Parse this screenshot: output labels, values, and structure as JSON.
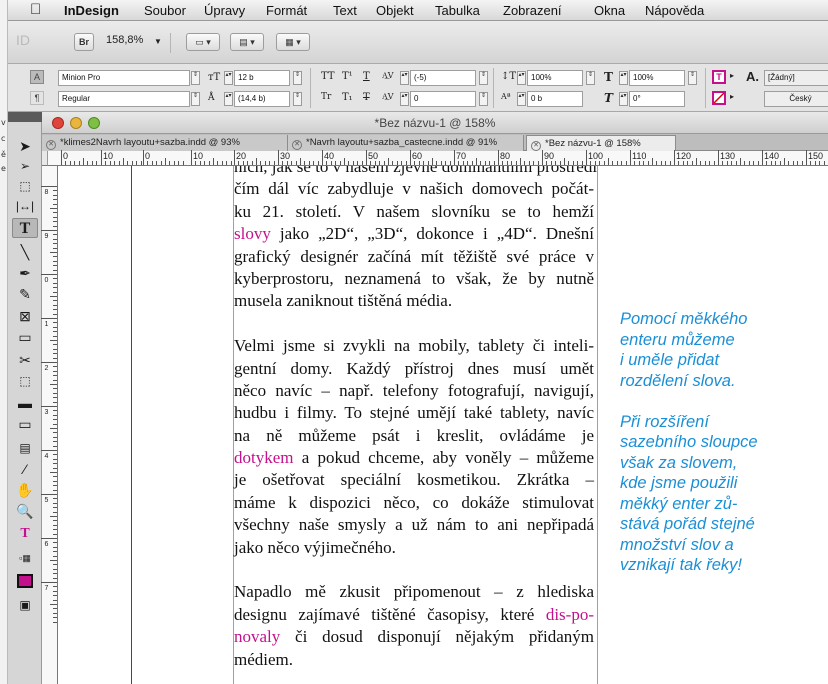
{
  "menu": {
    "app": "InDesign",
    "items": [
      "Soubor",
      "Úpravy",
      "Formát",
      "Text",
      "Objekt",
      "Tabulka",
      "Zobrazení",
      "Okna",
      "Nápověda"
    ]
  },
  "appbar": {
    "logo": "ID",
    "bridge": "Br",
    "zoom": "158,8%"
  },
  "control": {
    "font_family": "Minion Pro",
    "font_style": "Regular",
    "font_size": "12 b",
    "leading": "(14,4 b)",
    "tracking": "(-5)",
    "kerning": "0",
    "vscale": "100%",
    "hscale": "100%",
    "baseline": "0 b",
    "skew": "0°",
    "char_style": "[Žádný]",
    "language": "Český",
    "mode_a": "A",
    "mode_para": "¶"
  },
  "sliver": [
    "v",
    "c",
    "ě",
    "e"
  ],
  "document": {
    "window_title": "*Bez názvu-1 @ 158%",
    "tabs": [
      "*klimes2Navrh layoutu+sazba.indd @ 93%",
      "*Navrh layoutu+sazba_castecne.indd @ 91%",
      "*Bez názvu-1 @ 158%"
    ],
    "ruler_numbers": [
      "0",
      "10",
      "0",
      "10",
      "20",
      "30",
      "40",
      "50",
      "60",
      "70",
      "80",
      "90",
      "100",
      "110",
      "120",
      "130",
      "140",
      "150"
    ],
    "vruler_labels": [
      "8",
      "9",
      "0",
      "1",
      "2",
      "3",
      "4",
      "5",
      "6",
      "7"
    ]
  },
  "body": {
    "p0": [
      "ních, jak se to v našem zjevně dominantním prostředí",
      "čím dál víc zabydluje v našich domovech počát-",
      "ku 21. století. V našem slovníku se to hemží",
      [
        "slovy",
        " jako „2D“, „3D“, dokonce i „4D“. Dnešní"
      ],
      "grafický designér začíná mít těžiště své práce v",
      "kyberprostoru, neznamená to však, že by nutně",
      "musela zaniknout tištěná média."
    ],
    "p1": [
      "Velmi jsme si zvykli na mobily, tablety či inteli-",
      "gentní domy. Každý přístroj dnes musí umět",
      "něco navíc – např. telefony fotografují, navigují,",
      "hudbu i filmy. To stejné umějí také tablety, navíc",
      "na ně můžeme psát i kreslit, ovládáme je",
      [
        "dotykem",
        " a pokud chceme, aby voněly – můžeme"
      ],
      "je ošetřovat speciální kosmetikou. Zkrátka –",
      "máme k dispozici něco, co dokáže stimulovat",
      "všechny naše smysly a už nám to ani nepřipadá",
      "jako něco výjimečného."
    ],
    "p2": [
      [
        "Napadlo mě zkusit připomenout – z hlediska",
        ""
      ],
      [
        "designu zajímavé tištěné časopisy, které ",
        "dis-po-"
      ],
      [
        "novaly",
        " či dosud disponují nějakým přidaným"
      ],
      "médiem."
    ]
  },
  "note": {
    "lines1": [
      "Pomocí měkkého",
      "enteru můžeme",
      "i uměle přidat",
      "rozdělení slova."
    ],
    "lines2": [
      "Při rozšíření",
      "sazebního sloupce",
      "však za slovem,",
      "kde jsme použili",
      "měkký enter zů-",
      "stává pořád stejné",
      "množství slov a",
      "vznikají tak řeky!"
    ]
  },
  "colors": {
    "note_blue": "#1a8fd6",
    "highlight_magenta": "#c4108c",
    "margin_guide": "#b000b0",
    "frame_edge": "#8aa0d8"
  },
  "tools": [
    "selection-tool",
    "direct-selection-tool",
    "page-tool",
    "gap-tool",
    "type-tool",
    "line-tool",
    "pen-tool",
    "pencil-tool",
    "rect-frame-tool",
    "rectangle-tool",
    "scissors-tool",
    "free-transform-tool",
    "gradient-swatch-tool",
    "gradient-feather-tool",
    "note-tool",
    "eyedropper-tool",
    "hand-tool",
    "zoom-tool",
    "fill-stroke-widget",
    "formatting-affects",
    "color-swatch",
    "screen-mode"
  ]
}
